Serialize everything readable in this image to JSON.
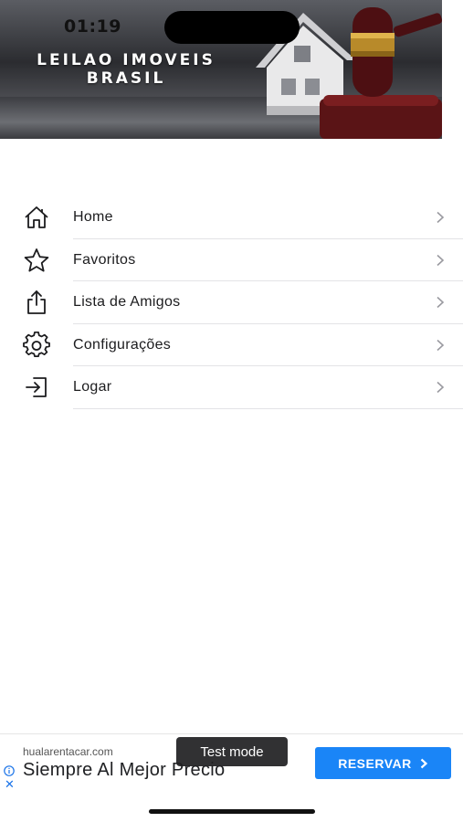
{
  "status_bar": {
    "time": "01:19"
  },
  "banner": {
    "title_line1": "LEILAO IMOVEIS",
    "title_line2": "BRASIL"
  },
  "menu": {
    "items": [
      {
        "label": "Home",
        "icon": "home-icon"
      },
      {
        "label": "Favoritos",
        "icon": "star-icon"
      },
      {
        "label": "Lista de Amigos",
        "icon": "share-icon"
      },
      {
        "label": "Configurações",
        "icon": "gear-icon"
      },
      {
        "label": "Logar",
        "icon": "login-icon"
      }
    ]
  },
  "ad": {
    "domain": "hualarentacar.com",
    "headline": "Siempre Al Mejor Precio",
    "cta_label": "RESERVAR",
    "test_mode_label": "Test mode",
    "close_glyph": "✕"
  },
  "colors": {
    "accent": "#1a85f7",
    "divider": "#e3e3e6",
    "text": "#1c1c1e"
  }
}
